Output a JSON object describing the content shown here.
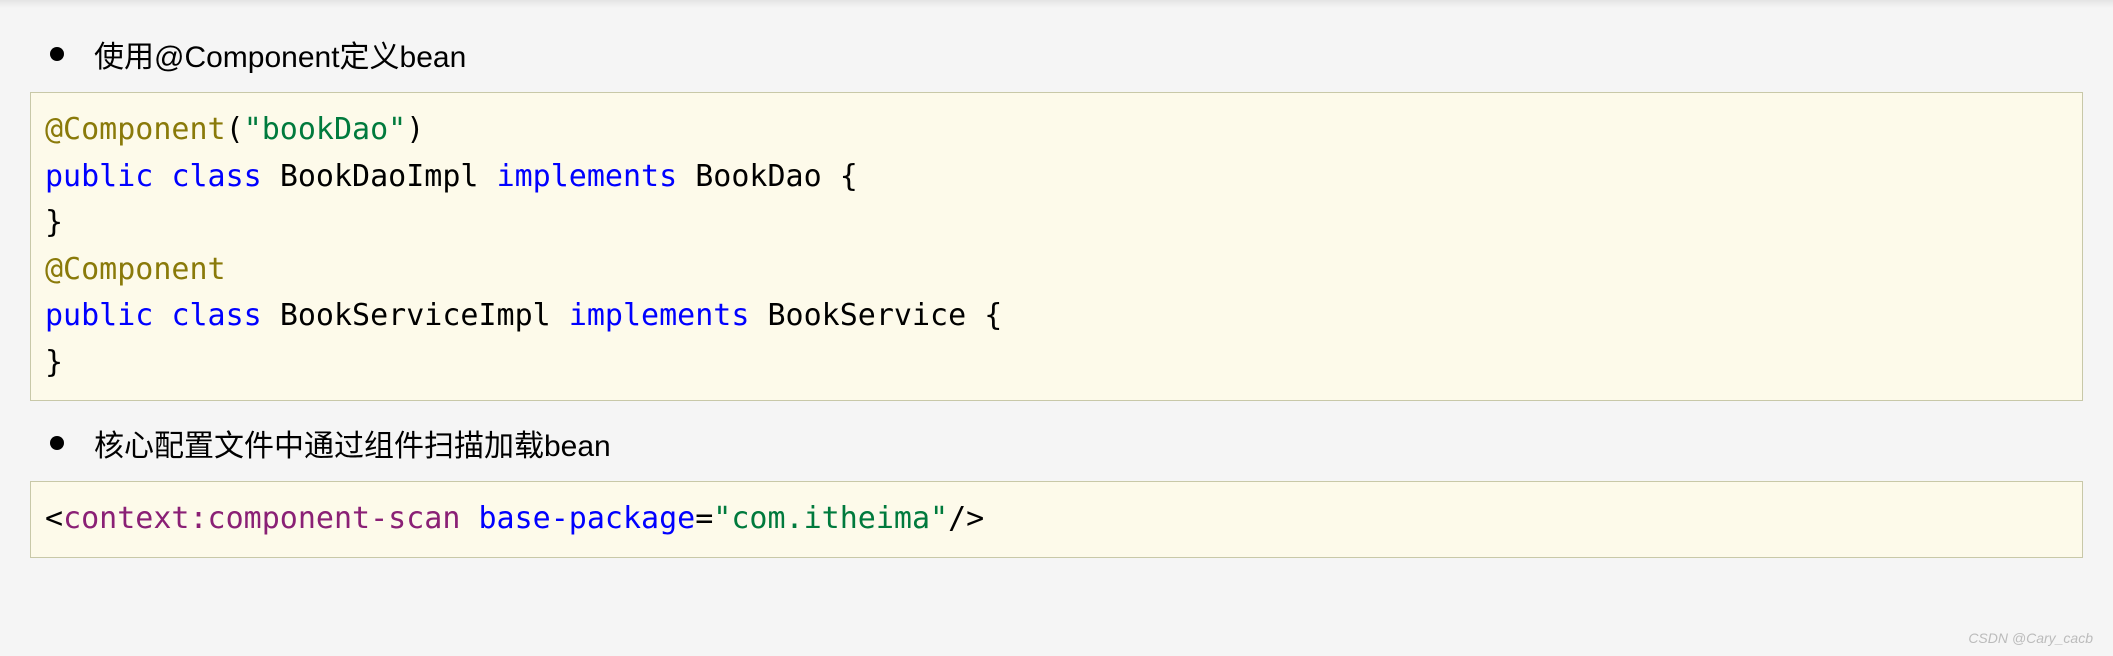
{
  "bullets": {
    "first": "使用@Component定义bean",
    "second": "核心配置文件中通过组件扫描加载bean"
  },
  "code1": {
    "line1": {
      "annotation": "@Component",
      "paren_open": "(",
      "string": "\"bookDao\"",
      "paren_close": ")"
    },
    "line2": {
      "kw_public": "public",
      "kw_class": "class",
      "classname": "BookDaoImpl",
      "kw_implements": "implements",
      "interface": "BookDao",
      "brace": "{"
    },
    "line3": {
      "brace": "}"
    },
    "line4": {
      "annotation": "@Component"
    },
    "line5": {
      "kw_public": "public",
      "kw_class": "class",
      "classname": "BookServiceImpl",
      "kw_implements": "implements",
      "interface": "BookService",
      "brace": "{"
    },
    "line6": {
      "brace": "}"
    }
  },
  "code2": {
    "lt": "<",
    "tag": "context:component-scan",
    "attr": "base-package",
    "eq": "=",
    "val": "\"com.itheima\"",
    "close": "/>"
  },
  "watermark": "CSDN @Cary_cacb"
}
